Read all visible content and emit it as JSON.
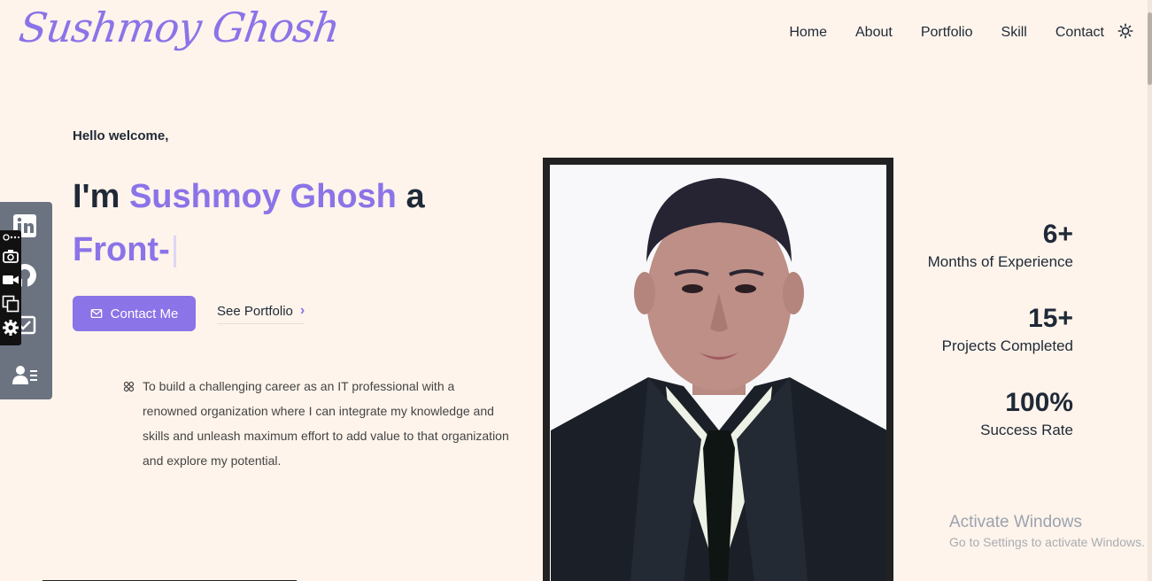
{
  "header": {
    "logo": "Sushmoy Ghosh",
    "nav": [
      "Home",
      "About",
      "Portfolio",
      "Skill",
      "Contact"
    ],
    "theme_icon": "sun-icon"
  },
  "hero": {
    "greeting": "Hello welcome,",
    "intro_prefix": "I'm",
    "name": "Sushmoy Ghosh",
    "intro_suffix": "a",
    "typed_role": "Front-",
    "contact_button": "Contact Me",
    "portfolio_button": "See Portfolio",
    "about": "To build a challenging career as an IT professional with a renowned organization where I can integrate my knowledge and skills and unleash maximum effort to add value to that organization and explore my potential."
  },
  "stats": [
    {
      "value": "6+",
      "label": "Months of Experience"
    },
    {
      "value": "15+",
      "label": "Projects Completed"
    },
    {
      "value": "100%",
      "label": "Success Rate"
    }
  ],
  "social_icons": [
    "linkedin-icon",
    "github-icon",
    "email-icon",
    "contact-card-icon"
  ],
  "overlay_icons": [
    "link-icon",
    "camera-icon",
    "video-icon",
    "copy-icon",
    "gear-icon"
  ],
  "watermark": {
    "title": "Activate Windows",
    "subtitle": "Go to Settings to activate Windows."
  },
  "colors": {
    "accent": "#8b73e8",
    "background": "#fef4eb",
    "text": "#1f2937",
    "social_bar": "#6b7280"
  }
}
